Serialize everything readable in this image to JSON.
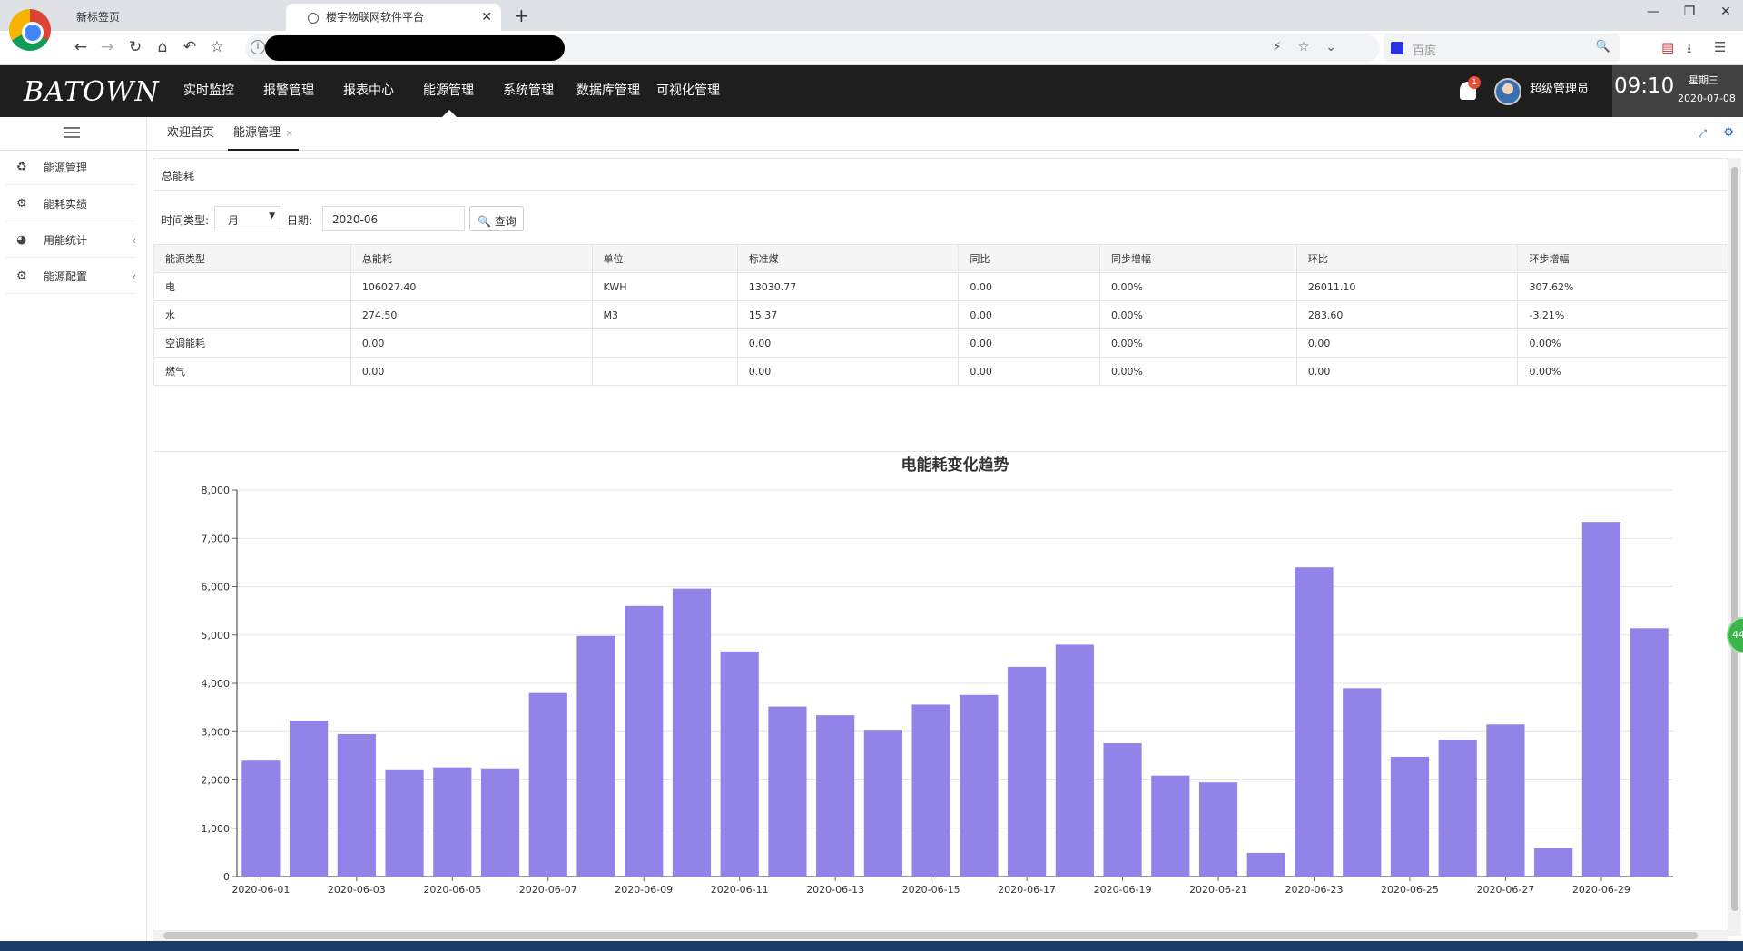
{
  "browser": {
    "tabs": [
      {
        "label": "新标签页"
      },
      {
        "label": "楼宇物联网软件平台"
      }
    ],
    "new_tab": "+",
    "search_placeholder": "百度"
  },
  "app": {
    "brand": "BATOWN",
    "nav": [
      "实时监控",
      "报警管理",
      "报表中心",
      "能源管理",
      "系统管理",
      "数据库管理",
      "可视化管理"
    ],
    "active_nav": "能源管理",
    "notifications": "1",
    "user": "超级管理员",
    "clock": {
      "time": "09:10",
      "weekday": "星期三",
      "date": "2020-07-08"
    }
  },
  "sidebar": {
    "items": [
      {
        "label": "能源管理",
        "icon": "recycle-icon"
      },
      {
        "label": "能耗实绩",
        "icon": "gear-icon"
      },
      {
        "label": "用能统计",
        "icon": "pie-chart-icon",
        "arrow": "‹"
      },
      {
        "label": "能源配置",
        "icon": "gear-icon",
        "arrow": "‹"
      }
    ]
  },
  "content_tabs": [
    {
      "label": "欢迎首页"
    },
    {
      "label": "能源管理",
      "close": "×"
    }
  ],
  "panel": {
    "title": "总能耗",
    "filter": {
      "time_type_label": "时间类型:",
      "time_type_value": "月",
      "date_label": "日期:",
      "date_value": "2020-06",
      "query_label": "查询"
    },
    "table": {
      "headers": [
        "能源类型",
        "总能耗",
        "单位",
        "标准煤",
        "同比",
        "同步增幅",
        "环比",
        "环步增幅"
      ],
      "rows": [
        [
          "电",
          "106027.40",
          "KWH",
          "13030.77",
          "0.00",
          "0.00%",
          "26011.10",
          "307.62%"
        ],
        [
          "水",
          "274.50",
          "M3",
          "15.37",
          "0.00",
          "0.00%",
          "283.60",
          "-3.21%"
        ],
        [
          "空调能耗",
          "0.00",
          "",
          "0.00",
          "0.00",
          "0.00%",
          "0.00",
          "0.00%"
        ],
        [
          "燃气",
          "0.00",
          "",
          "0.00",
          "0.00",
          "0.00%",
          "0.00",
          "0.00%"
        ]
      ]
    }
  },
  "float_handle": "44",
  "chart_data": {
    "type": "bar",
    "title": "电能耗变化趋势",
    "categories": [
      "2020-06-01",
      "2020-06-02",
      "2020-06-03",
      "2020-06-04",
      "2020-06-05",
      "2020-06-06",
      "2020-06-07",
      "2020-06-08",
      "2020-06-09",
      "2020-06-10",
      "2020-06-11",
      "2020-06-12",
      "2020-06-13",
      "2020-06-14",
      "2020-06-15",
      "2020-06-16",
      "2020-06-17",
      "2020-06-18",
      "2020-06-19",
      "2020-06-20",
      "2020-06-21",
      "2020-06-22",
      "2020-06-23",
      "2020-06-24",
      "2020-06-25",
      "2020-06-26",
      "2020-06-27",
      "2020-06-28",
      "2020-06-29",
      "2020-06-30"
    ],
    "x_tick_labels": [
      "2020-06-01",
      "2020-06-03",
      "2020-06-05",
      "2020-06-07",
      "2020-06-09",
      "2020-06-11",
      "2020-06-13",
      "2020-06-15",
      "2020-06-17",
      "2020-06-19",
      "2020-06-21",
      "2020-06-23",
      "2020-06-25",
      "2020-06-27",
      "2020-06-29"
    ],
    "values": [
      2400,
      3230,
      2950,
      2220,
      2260,
      2240,
      3800,
      4980,
      5600,
      5960,
      4660,
      3520,
      3340,
      3020,
      3560,
      3760,
      4340,
      4800,
      2760,
      2090,
      1950,
      490,
      6400,
      3900,
      2480,
      2830,
      3150,
      590,
      7340,
      5140
    ],
    "ylim": [
      0,
      8000
    ],
    "y_ticks": [
      "0",
      "1,000",
      "2,000",
      "3,000",
      "4,000",
      "5,000",
      "6,000",
      "7,000",
      "8,000"
    ],
    "bar_color": "#9283e8",
    "grid": true,
    "legend": "none"
  }
}
